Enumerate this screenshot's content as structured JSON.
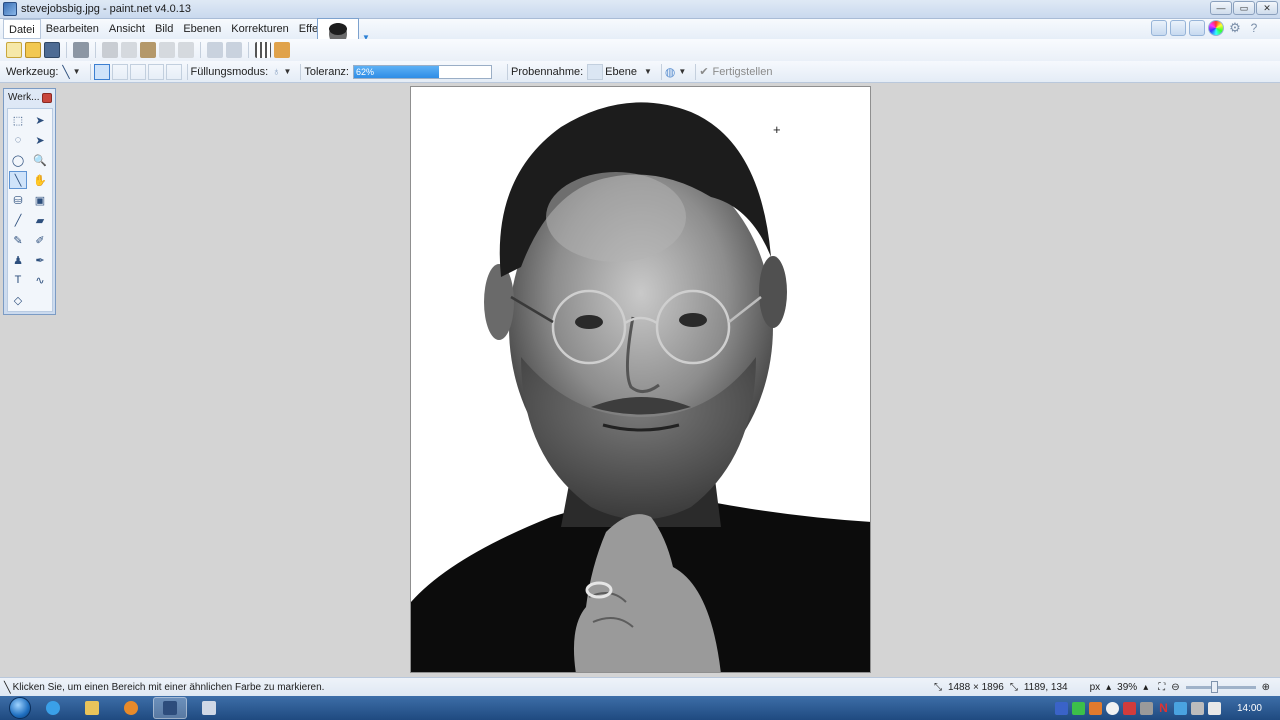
{
  "window": {
    "title": "stevejobsbig.jpg - paint.net v4.0.13",
    "controls": [
      "—",
      "▭",
      "✕"
    ]
  },
  "menu": {
    "items": [
      "Datei",
      "Bearbeiten",
      "Ansicht",
      "Bild",
      "Ebenen",
      "Korrekturen",
      "Effekte"
    ]
  },
  "tool_options": {
    "tool_label": "Werkzeug:",
    "fill_mode_label": "Füllungsmodus:",
    "tolerance_label": "Toleranz:",
    "tolerance_value": "62%",
    "tolerance_fraction": 0.62,
    "sampling_label": "Probennahme:",
    "sampling_value": "Ebene",
    "finish_label": "Fertigstellen"
  },
  "tools_window": {
    "title": "Werk..."
  },
  "tools": [
    {
      "name": "rectangle-select-tool",
      "glyph": "⬚"
    },
    {
      "name": "move-selection-tool",
      "glyph": "➤"
    },
    {
      "name": "lasso-select-tool",
      "glyph": "◌"
    },
    {
      "name": "move-selected-tool",
      "glyph": "➤"
    },
    {
      "name": "ellipse-select-tool",
      "glyph": "◯"
    },
    {
      "name": "zoom-tool",
      "glyph": "🔍"
    },
    {
      "name": "magic-wand-tool",
      "glyph": "╲",
      "active": true
    },
    {
      "name": "pan-tool",
      "glyph": "✋"
    },
    {
      "name": "paint-bucket-tool",
      "glyph": "⛁"
    },
    {
      "name": "gradient-tool",
      "glyph": "▣"
    },
    {
      "name": "paintbrush-tool",
      "glyph": "╱"
    },
    {
      "name": "eraser-tool",
      "glyph": "▰"
    },
    {
      "name": "pencil-tool",
      "glyph": "✎"
    },
    {
      "name": "color-picker-tool",
      "glyph": "✐"
    },
    {
      "name": "clone-stamp-tool",
      "glyph": "♟"
    },
    {
      "name": "recolor-tool",
      "glyph": "✒"
    },
    {
      "name": "text-tool",
      "glyph": "T"
    },
    {
      "name": "line-curve-tool",
      "glyph": "∿"
    },
    {
      "name": "shapes-tool",
      "glyph": "◇"
    }
  ],
  "status": {
    "hint": "Klicken Sie, um einen Bereich mit einer ähnlichen Farbe zu markieren.",
    "image_size": "1488 × 1896",
    "cursor_pos": "1189, 134",
    "unit": "px",
    "zoom": "39%"
  },
  "taskbar": {
    "clock": "14:00"
  },
  "colors": {
    "accent": "#3c7fd1",
    "taskbar": "#1f4a80"
  }
}
